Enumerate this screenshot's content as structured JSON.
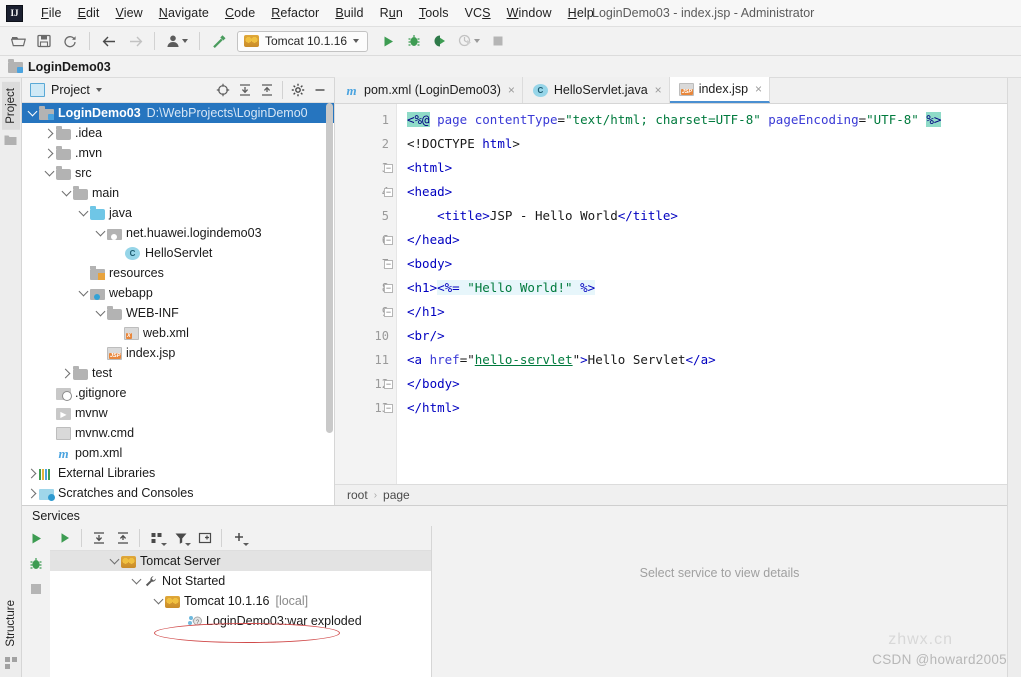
{
  "window": {
    "title": "LoginDemo03 - index.jsp - Administrator",
    "logo": "intellij-idea-logo"
  },
  "menubar": {
    "items": [
      {
        "label": "File",
        "mnemonic": "F"
      },
      {
        "label": "Edit",
        "mnemonic": "E"
      },
      {
        "label": "View",
        "mnemonic": "V"
      },
      {
        "label": "Navigate",
        "mnemonic": "N"
      },
      {
        "label": "Code",
        "mnemonic": "C"
      },
      {
        "label": "Refactor",
        "mnemonic": "R"
      },
      {
        "label": "Build",
        "mnemonic": "B"
      },
      {
        "label": "Run",
        "mnemonic": "u"
      },
      {
        "label": "Tools",
        "mnemonic": "T"
      },
      {
        "label": "VCS",
        "mnemonic": "S"
      },
      {
        "label": "Window",
        "mnemonic": "W"
      },
      {
        "label": "Help",
        "mnemonic": "H"
      }
    ]
  },
  "toolbar": {
    "open_icon": "open-folder-icon",
    "save_icon": "save-all-icon",
    "sync_icon": "reload-from-disk-icon",
    "back_icon": "navigate-back-icon",
    "forward_icon": "navigate-forward-icon",
    "profile_icon": "user-profile-icon",
    "build_icon": "build-hammer-icon",
    "run_config": "Tomcat 10.1.16",
    "run_config_icon": "tomcat-icon",
    "run_icon": "run-icon",
    "debug_icon": "debug-icon",
    "run_coverage_icon": "run-with-coverage-icon",
    "profiler_icon": "profiler-icon",
    "stop_icon": "stop-icon"
  },
  "navbar": {
    "project": "LoginDemo03",
    "icon": "module-icon"
  },
  "left_strip": {
    "project_tab": "Project",
    "structure_tab": "Structure"
  },
  "project_panel": {
    "title": "Project",
    "actions": [
      "select-opened-file-icon",
      "expand-all-icon",
      "collapse-all-icon",
      "settings-gear-icon",
      "hide-icon"
    ],
    "tree": [
      {
        "label": "LoginDemo03",
        "detail": "D:\\WebProjects\\LoginDemo0",
        "indent": 0,
        "arrow": "down",
        "icon": "module",
        "selected": true,
        "bold": true
      },
      {
        "label": ".idea",
        "indent": 1,
        "arrow": "right",
        "icon": "folder"
      },
      {
        "label": ".mvn",
        "indent": 1,
        "arrow": "right",
        "icon": "folder"
      },
      {
        "label": "src",
        "indent": 1,
        "arrow": "down",
        "icon": "folder"
      },
      {
        "label": "main",
        "indent": 2,
        "arrow": "down",
        "icon": "folder"
      },
      {
        "label": "java",
        "indent": 3,
        "arrow": "down",
        "icon": "folder-blue"
      },
      {
        "label": "net.huawei.logindemo03",
        "indent": 4,
        "arrow": "down",
        "icon": "package"
      },
      {
        "label": "HelloServlet",
        "indent": 5,
        "arrow": "none",
        "icon": "class"
      },
      {
        "label": "resources",
        "indent": 3,
        "arrow": "none",
        "icon": "resources"
      },
      {
        "label": "webapp",
        "indent": 3,
        "arrow": "down",
        "icon": "webapp"
      },
      {
        "label": "WEB-INF",
        "indent": 4,
        "arrow": "down",
        "icon": "folder"
      },
      {
        "label": "web.xml",
        "indent": 5,
        "arrow": "none",
        "icon": "xml-file"
      },
      {
        "label": "index.jsp",
        "indent": 4,
        "arrow": "none",
        "icon": "jsp-file"
      },
      {
        "label": "test",
        "indent": 2,
        "arrow": "right",
        "icon": "folder"
      },
      {
        "label": ".gitignore",
        "indent": 1,
        "arrow": "none",
        "icon": "gitignore-file"
      },
      {
        "label": "mvnw",
        "indent": 1,
        "arrow": "none",
        "icon": "script-file"
      },
      {
        "label": "mvnw.cmd",
        "indent": 1,
        "arrow": "none",
        "icon": "cmd-file"
      },
      {
        "label": "pom.xml",
        "indent": 1,
        "arrow": "none",
        "icon": "maven-file"
      },
      {
        "label": "External Libraries",
        "indent": 0,
        "arrow": "right",
        "icon": "libraries"
      },
      {
        "label": "Scratches and Consoles",
        "indent": 0,
        "arrow": "right",
        "icon": "scratches"
      }
    ]
  },
  "editor": {
    "tabs": [
      {
        "label": "pom.xml (LoginDemo03)",
        "icon": "maven-file",
        "active": false,
        "close": "×"
      },
      {
        "label": "HelloServlet.java",
        "icon": "class",
        "active": false,
        "close": "×"
      },
      {
        "label": "index.jsp",
        "icon": "jsp-file",
        "active": true,
        "close": "×"
      }
    ],
    "line_numbers": [
      "1",
      "2",
      "3",
      "4",
      "5",
      "6",
      "7",
      "8",
      "9",
      "10",
      "11",
      "12",
      "13"
    ],
    "lines": [
      "<%@ page contentType=\"text/html; charset=UTF-8\" pageEncoding=\"UTF-8\" %>",
      "<!DOCTYPE html>",
      "<html>",
      "<head>",
      "    <title>JSP - Hello World</title>",
      "</head>",
      "<body>",
      "<h1><%= \"Hello World!\" %>",
      "</h1>",
      "<br/>",
      "<a href=\"hello-servlet\">Hello Servlet</a>",
      "</body>",
      "</html>"
    ],
    "breadcrumbs": [
      "root",
      "page"
    ],
    "breadcrumb_separator": "›"
  },
  "services": {
    "title": "Services",
    "toolbar_icons": [
      "run-icon",
      "expand-all-icon",
      "collapse-all-icon",
      "group-by-icon",
      "filter-icon",
      "add-tab-icon",
      "add-service-icon"
    ],
    "rail_icons": [
      "run-icon",
      "debug-icon",
      "stop-icon"
    ],
    "tree": [
      {
        "label": "Tomcat Server",
        "indent": 0,
        "arrow": "down",
        "icon": "tomcat",
        "highlight": true
      },
      {
        "label": "Not Started",
        "indent": 1,
        "arrow": "down",
        "icon": "wrench"
      },
      {
        "label": "Tomcat 10.1.16",
        "detail": "[local]",
        "indent": 2,
        "arrow": "down",
        "icon": "tomcat"
      },
      {
        "label": "LoginDemo03:war exploded",
        "indent": 3,
        "arrow": "none",
        "icon": "artifact",
        "annotated": true
      }
    ],
    "detail_message": "Select service to view details"
  },
  "watermark": {
    "primary": "CSDN @howard2005",
    "secondary": "zhwx.cn"
  },
  "colors": {
    "selection_blue": "#2675bf",
    "accent_green": "#3d9c52",
    "scriptlet_teal": "#8fdbc8",
    "string_green": "#007a3d",
    "tag_blue": "#0000c0",
    "annotation_red": "#d04a4a"
  }
}
